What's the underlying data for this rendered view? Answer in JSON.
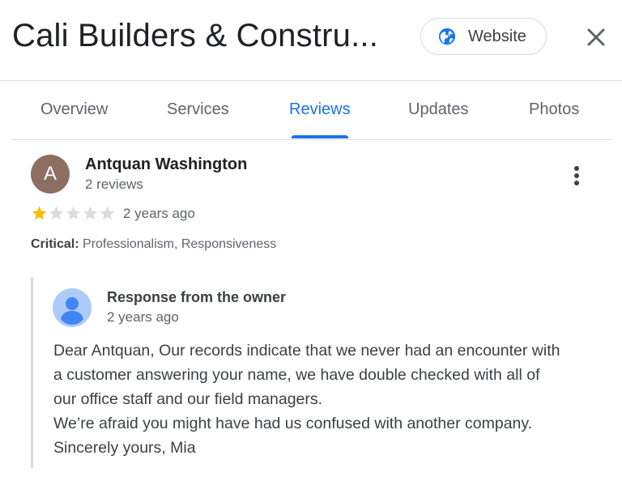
{
  "header": {
    "title": "Cali Builders & Constru...",
    "website_label": "Website",
    "icons": {
      "globe": "globe-icon",
      "close": "close-icon"
    }
  },
  "tabs": [
    {
      "label": "Overview"
    },
    {
      "label": "Services"
    },
    {
      "label": "Reviews",
      "active": true
    },
    {
      "label": "Updates"
    },
    {
      "label": "Photos"
    }
  ],
  "review": {
    "avatar_letter": "A",
    "reviewer_name": "Antquan Washington",
    "review_count": "2 reviews",
    "rating": 1,
    "rating_max": 5,
    "time": "2 years ago",
    "critical_label": "Critical:",
    "critical_value": "Professionalism, Responsiveness"
  },
  "response": {
    "title": "Response from the owner",
    "time": "2 years ago",
    "lines": [
      "Dear Antquan, Our records indicate that we never had an encounter with",
      "a customer answering your name, we have double checked with all of",
      "our office staff and our field managers.",
      "We’re afraid you might have had us confused with another company.",
      "Sincerely yours, Mia"
    ]
  },
  "colors": {
    "accent": "#1a73e8",
    "star_filled": "#fbbc04",
    "star_empty": "#dadce0",
    "avatar_bg": "#8d6e63",
    "owner_avatar_bg": "#aecbfa",
    "owner_avatar_fg": "#4285f4"
  }
}
